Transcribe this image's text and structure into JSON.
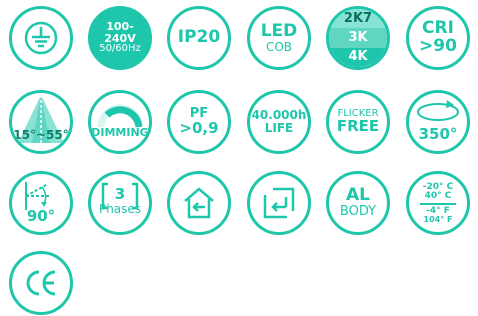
{
  "badges": {
    "ground": {
      "icon": "ground-icon"
    },
    "voltage": {
      "line1": "100-240V",
      "line2": "50/60Hz"
    },
    "ip": {
      "label": "IP20"
    },
    "led": {
      "line1": "LED",
      "line2": "COB"
    },
    "cct": {
      "rows": [
        "2K7",
        "3K",
        "4K"
      ]
    },
    "cri": {
      "line1": "CRI",
      "line2": ">90"
    },
    "beam": {
      "label": "15°~55°",
      "icon": "beam-angle-icon"
    },
    "dimming": {
      "label": "DIMMING",
      "icon": "dimming-arc-icon"
    },
    "pf": {
      "line1": "PF",
      "line2": ">0,9"
    },
    "life": {
      "line1": "40.000h",
      "line2": "LIFE"
    },
    "flicker": {
      "line1": "FLICKER",
      "line2": "FREE"
    },
    "rotation": {
      "label": "350°",
      "icon": "rotation-arrow-icon"
    },
    "tilt": {
      "label": "90°",
      "icon": "tilt-angle-icon"
    },
    "phases": {
      "number": "3",
      "label": "Phases",
      "icon": "track-bracket-icon"
    },
    "indoor": {
      "icon": "indoor-use-icon"
    },
    "surface": {
      "icon": "surface-mount-icon"
    },
    "body": {
      "line1": "AL",
      "line2": "BODY"
    },
    "temp": {
      "c_min": "-20° C",
      "c_max": "40° C",
      "f_min": "-4° F",
      "f_max": "104° F"
    },
    "ce": {
      "label": "CE",
      "icon": "ce-mark-icon"
    }
  },
  "colors": {
    "accent": "#1ec6ac",
    "light": "#87e3d4",
    "mid": "#5fd6c2",
    "background": "#ffffff"
  }
}
